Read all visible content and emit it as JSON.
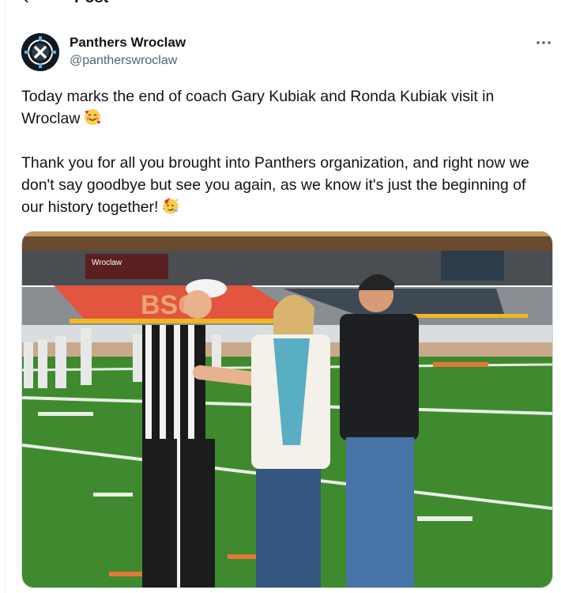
{
  "header": {
    "title": "Post"
  },
  "author": {
    "display_name": "Panthers Wroclaw",
    "handle": "@pantherswroclaw"
  },
  "post": {
    "paragraph_1": "Today marks the end of coach Gary Kubiak and Ronda Kubiak visit in Wroclaw",
    "paragraph_2": "Thank you for all you brought into Panthers organization, and right now we don't say goodbye but see you again, as we know it's just the beginning of our history together!"
  },
  "icons": {
    "back": "arrow-left-icon",
    "more": "more-horizontal-icon",
    "emoji_1": "smiling-face-with-hearts-emoji",
    "emoji_2": "partying-face-emoji"
  },
  "photo": {
    "stadium_sign": "Wroclaw"
  },
  "colors": {
    "text": "#0f1419",
    "secondary": "#536471",
    "border": "#cfd9de"
  }
}
